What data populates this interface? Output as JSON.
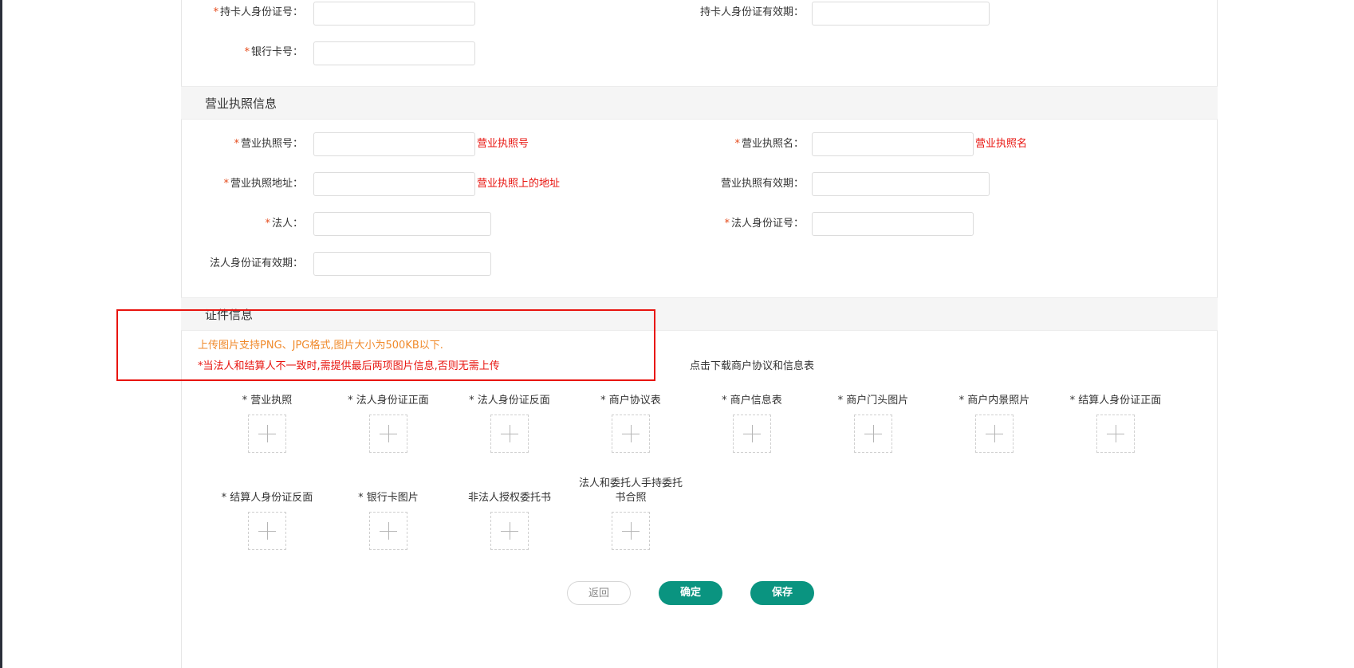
{
  "card_section": {
    "fields": [
      {
        "label": "持卡人身份证号：",
        "required": true
      },
      {
        "label": "持卡人身份证有效期：",
        "required": false
      },
      {
        "label": "银行卡号：",
        "required": true
      }
    ]
  },
  "license_section": {
    "title": "营业执照信息",
    "fields": [
      {
        "label": "营业执照号：",
        "required": true,
        "hint": "营业执照号"
      },
      {
        "label": "营业执照名：",
        "required": true,
        "hint": "营业执照名"
      },
      {
        "label": "营业执照地址：",
        "required": true,
        "hint": "营业执照上的地址"
      },
      {
        "label": "营业执照有效期：",
        "required": false
      },
      {
        "label": "法人：",
        "required": true
      },
      {
        "label": "法人身份证号：",
        "required": true
      },
      {
        "label": "法人身份证有效期：",
        "required": false
      }
    ]
  },
  "cert_section": {
    "title": "证件信息",
    "note_format": "上传图片支持PNG、JPG格式,图片大小为500KB以下.",
    "note_required": "*当法人和结算人不一致时,需提供最后两项图片信息,否则无需上传",
    "download_link": "点击下载商户协议和信息表",
    "uploads": [
      {
        "label": "* 营业执照"
      },
      {
        "label": "* 法人身份证正面"
      },
      {
        "label": "* 法人身份证反面"
      },
      {
        "label": "* 商户协议表"
      },
      {
        "label": "* 商户信息表"
      },
      {
        "label": "* 商户门头图片"
      },
      {
        "label": "* 商户内景照片"
      },
      {
        "label": "* 结算人身份证正面"
      },
      {
        "label": "* 结算人身份证反面"
      },
      {
        "label": "* 银行卡图片"
      },
      {
        "label": "非法人授权委托书"
      },
      {
        "label": "法人和委托人手持委托书合照"
      }
    ]
  },
  "buttons": {
    "back": "返回",
    "confirm": "确定",
    "save": "保存"
  },
  "colors": {
    "primary": "#0a9480",
    "required_star": "#e54b1c",
    "hint_red": "#e8140f",
    "note_orange": "#f08a2b"
  },
  "icons": {
    "upload": "plus-icon"
  }
}
